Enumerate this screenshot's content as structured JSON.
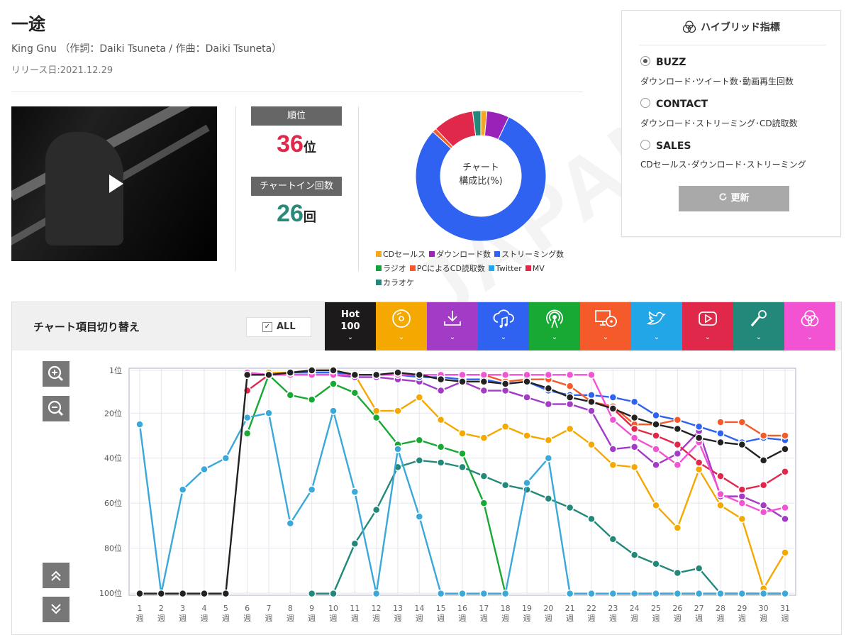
{
  "song": {
    "title": "一途",
    "artist_line": "King Gnu （作詞：Daiki Tsuneta / 作曲：Daiki Tsuneta）",
    "release": "リリース日:2021.12.29"
  },
  "stats": {
    "rank_label": "順位",
    "rank_value": "36",
    "rank_unit": "位",
    "count_label": "チャートイン回数",
    "count_value": "26",
    "count_unit": "回"
  },
  "donut": {
    "center_line1": "チャート",
    "center_line2": "構成比(%)",
    "slices": [
      {
        "name": "CDセールス",
        "value": 1.5,
        "color": "#f5a623"
      },
      {
        "name": "ダウンロード数",
        "value": 5.5,
        "color": "#9b22b8"
      },
      {
        "name": "ストリーミング数",
        "value": 79,
        "color": "#2f62f0"
      },
      {
        "name": "ラジオ",
        "value": 0,
        "color": "#17a03a"
      },
      {
        "name": "PCによるCD読取数",
        "value": 1,
        "color": "#f55a2a"
      },
      {
        "name": "Twitter",
        "value": 0,
        "color": "#23a6e8"
      },
      {
        "name": "MV",
        "value": 10,
        "color": "#e0294a"
      },
      {
        "name": "カラオケ",
        "value": 2,
        "color": "#22897a"
      }
    ]
  },
  "hybrid": {
    "title": "ハイブリッド指標",
    "options": [
      {
        "label": "BUZZ",
        "desc": "ダウンロード･ツイート数･動画再生回数",
        "selected": true
      },
      {
        "label": "CONTACT",
        "desc": "ダウンロード･ストリーミング･CD読取数",
        "selected": false
      },
      {
        "label": "SALES",
        "desc": "CDセールス･ダウンロード･ストリーミング",
        "selected": false
      }
    ],
    "update_label": "更新"
  },
  "toolbar": {
    "label": "チャート項目切り替え",
    "all_label": "ALL",
    "all_checked": true,
    "tabs": [
      {
        "name": "hot100",
        "line1": "Hot",
        "line2": "100",
        "color": "#1c1a1a"
      },
      {
        "name": "cd-sales",
        "icon": "cd-icon",
        "color": "#f5a800"
      },
      {
        "name": "download",
        "icon": "download-icon",
        "color": "#a23bc6"
      },
      {
        "name": "streaming",
        "icon": "cloud-music-icon",
        "color": "#2f62f0"
      },
      {
        "name": "radio",
        "icon": "radio-icon",
        "color": "#18a834"
      },
      {
        "name": "pc-read",
        "icon": "pc-cd-icon",
        "color": "#f45a2a"
      },
      {
        "name": "twitter",
        "icon": "twitter-icon",
        "color": "#23a6e8"
      },
      {
        "name": "mv",
        "icon": "play-icon",
        "color": "#e0294a"
      },
      {
        "name": "karaoke",
        "icon": "microphone-icon",
        "color": "#22897a"
      },
      {
        "name": "hybrid",
        "icon": "hybrid-icon",
        "color": "#f253d3"
      }
    ]
  },
  "chart_data": {
    "type": "line",
    "x": [
      1,
      2,
      3,
      4,
      5,
      6,
      7,
      8,
      9,
      10,
      11,
      12,
      13,
      14,
      15,
      16,
      17,
      18,
      19,
      20,
      21,
      22,
      23,
      24,
      25,
      26,
      27,
      28,
      29,
      30,
      31
    ],
    "x_tick_labels": [
      "1\n週",
      "2\n週",
      "3\n週",
      "4\n週",
      "5\n週",
      "6\n週",
      "7\n週",
      "8\n週",
      "9\n週",
      "10\n週",
      "11\n週",
      "12\n週",
      "13\n週",
      "14\n週",
      "15\n週",
      "16\n週",
      "17\n週",
      "18\n週",
      "19\n週",
      "20\n週",
      "21\n週",
      "22\n週",
      "23\n週",
      "24\n週",
      "25\n週",
      "26\n週",
      "27\n週",
      "28\n週",
      "29\n週",
      "30\n週",
      "31\n週"
    ],
    "y_ticks": [
      1,
      20,
      40,
      60,
      80,
      100
    ],
    "y_tick_labels": [
      "1位",
      "20位",
      "40位",
      "60位",
      "80位",
      "100位"
    ],
    "ylim": [
      1,
      100
    ],
    "y_inverted": true,
    "series": [
      {
        "key": "cd",
        "color": "#f5a800",
        "values": [
          null,
          null,
          null,
          null,
          null,
          null,
          2,
          2,
          1,
          1,
          3,
          19,
          19,
          13,
          23,
          29,
          31,
          26,
          30,
          32,
          27,
          34,
          43,
          44,
          61,
          71,
          45,
          61,
          67,
          98,
          82
        ]
      },
      {
        "key": "download",
        "color": "#a23bc6",
        "values": [
          null,
          null,
          null,
          null,
          null,
          2,
          3,
          3,
          3,
          3,
          4,
          4,
          5,
          6,
          10,
          6,
          10,
          10,
          13,
          16,
          16,
          19,
          36,
          35,
          43,
          38,
          28,
          57,
          57,
          61,
          67
        ]
      },
      {
        "key": "streaming",
        "color": "#2f62f0",
        "values": [
          null,
          null,
          null,
          null,
          null,
          null,
          null,
          2,
          2,
          2,
          3,
          3,
          3,
          4,
          4,
          5,
          5,
          7,
          6,
          10,
          12,
          12,
          13,
          15,
          21,
          23,
          26,
          29,
          33,
          31,
          32
        ]
      },
      {
        "key": "radio",
        "color": "#18a834",
        "values": [
          null,
          null,
          null,
          null,
          null,
          29,
          3,
          12,
          14,
          7,
          11,
          22,
          34,
          32,
          35,
          38,
          60,
          101,
          null,
          null,
          null,
          null,
          null,
          101,
          101,
          101,
          101,
          101,
          101,
          101,
          101
        ]
      },
      {
        "key": "pc",
        "color": "#f45a2a",
        "values": [
          null,
          null,
          null,
          null,
          null,
          null,
          null,
          null,
          null,
          null,
          null,
          null,
          null,
          null,
          3,
          3,
          3,
          6,
          5,
          5,
          8,
          15,
          17,
          25,
          25,
          23,
          null,
          24,
          24,
          30,
          30
        ]
      },
      {
        "key": "mv",
        "color": "#e0294a",
        "values": [
          null,
          null,
          null,
          null,
          null,
          10,
          3,
          null,
          null,
          null,
          null,
          null,
          null,
          null,
          null,
          null,
          null,
          null,
          4,
          null,
          null,
          15,
          18,
          27,
          30,
          34,
          42,
          48,
          54,
          52,
          46
        ]
      },
      {
        "key": "hybrid",
        "color": "#f253d3",
        "values": [
          null,
          null,
          null,
          null,
          null,
          2,
          3,
          3,
          3,
          3,
          3,
          3,
          3,
          3,
          3,
          3,
          3,
          3,
          3,
          3,
          3,
          3,
          23,
          31,
          36,
          43,
          33,
          56,
          60,
          64,
          62
        ]
      },
      {
        "key": "karaoke",
        "color": "#22897a",
        "values": [
          null,
          null,
          null,
          null,
          null,
          null,
          null,
          null,
          101,
          101,
          78,
          63,
          44,
          41,
          42,
          44,
          48,
          52,
          54,
          58,
          62,
          67,
          76,
          83,
          87,
          91,
          89,
          101,
          101,
          101,
          101
        ]
      },
      {
        "key": "twitter",
        "color": "#3aa8d9",
        "values": [
          25,
          101,
          54,
          45,
          40,
          22,
          20,
          69,
          54,
          19,
          55,
          101,
          36,
          66,
          101,
          101,
          101,
          101,
          51,
          40,
          101,
          101,
          101,
          101,
          101,
          101,
          101,
          101,
          101,
          101,
          101
        ]
      },
      {
        "key": "hot100",
        "color": "#222222",
        "values": [
          101,
          101,
          101,
          101,
          101,
          3,
          3,
          2,
          1,
          1,
          3,
          3,
          2,
          3,
          5,
          6,
          6,
          7,
          6,
          9,
          13,
          15,
          18,
          22,
          25,
          27,
          31,
          33,
          34,
          41,
          36
        ]
      }
    ]
  }
}
